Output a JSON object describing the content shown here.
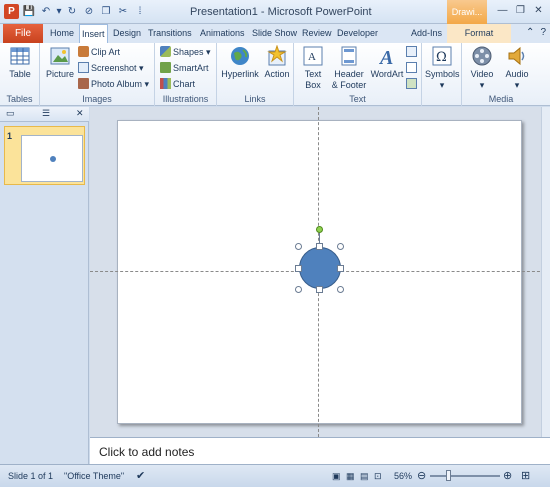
{
  "titlebar": {
    "title": "Presentation1 - Microsoft PowerPoint",
    "context_tab": "Drawi...",
    "app_icon_letter": "P"
  },
  "tabs": {
    "file": "File",
    "items": [
      "Home",
      "Insert",
      "Design",
      "Transitions",
      "Animations",
      "Slide Show",
      "Review",
      "Developer",
      "Add-Ins"
    ],
    "format": "Format"
  },
  "ribbon": {
    "tables": {
      "table": "Table",
      "label": "Tables"
    },
    "images": {
      "picture": "Picture",
      "clip_art": "Clip Art",
      "screenshot": "Screenshot",
      "photo_album": "Photo Album",
      "label": "Images"
    },
    "illustrations": {
      "shapes": "Shapes",
      "smartart": "SmartArt",
      "chart": "Chart",
      "label": "Illustrations"
    },
    "links": {
      "hyperlink": "Hyperlink",
      "action": "Action",
      "label": "Links"
    },
    "text": {
      "text_box_1": "Text",
      "text_box_2": "Box",
      "header_1": "Header",
      "header_2": "& Footer",
      "wordart": "WordArt",
      "label": "Text"
    },
    "symbols": {
      "symbols": "Symbols"
    },
    "media": {
      "video": "Video",
      "audio": "Audio",
      "label": "Media"
    }
  },
  "slides_panel": {
    "slide_number": "1"
  },
  "notes": {
    "placeholder": "Click to add notes"
  },
  "status": {
    "slide": "Slide 1 of 1",
    "theme": "\"Office Theme\"",
    "zoom": "56%"
  },
  "colors": {
    "shape_fill": "#4f81bd",
    "file_tab": "#d24726",
    "accent": "#1e395b"
  }
}
